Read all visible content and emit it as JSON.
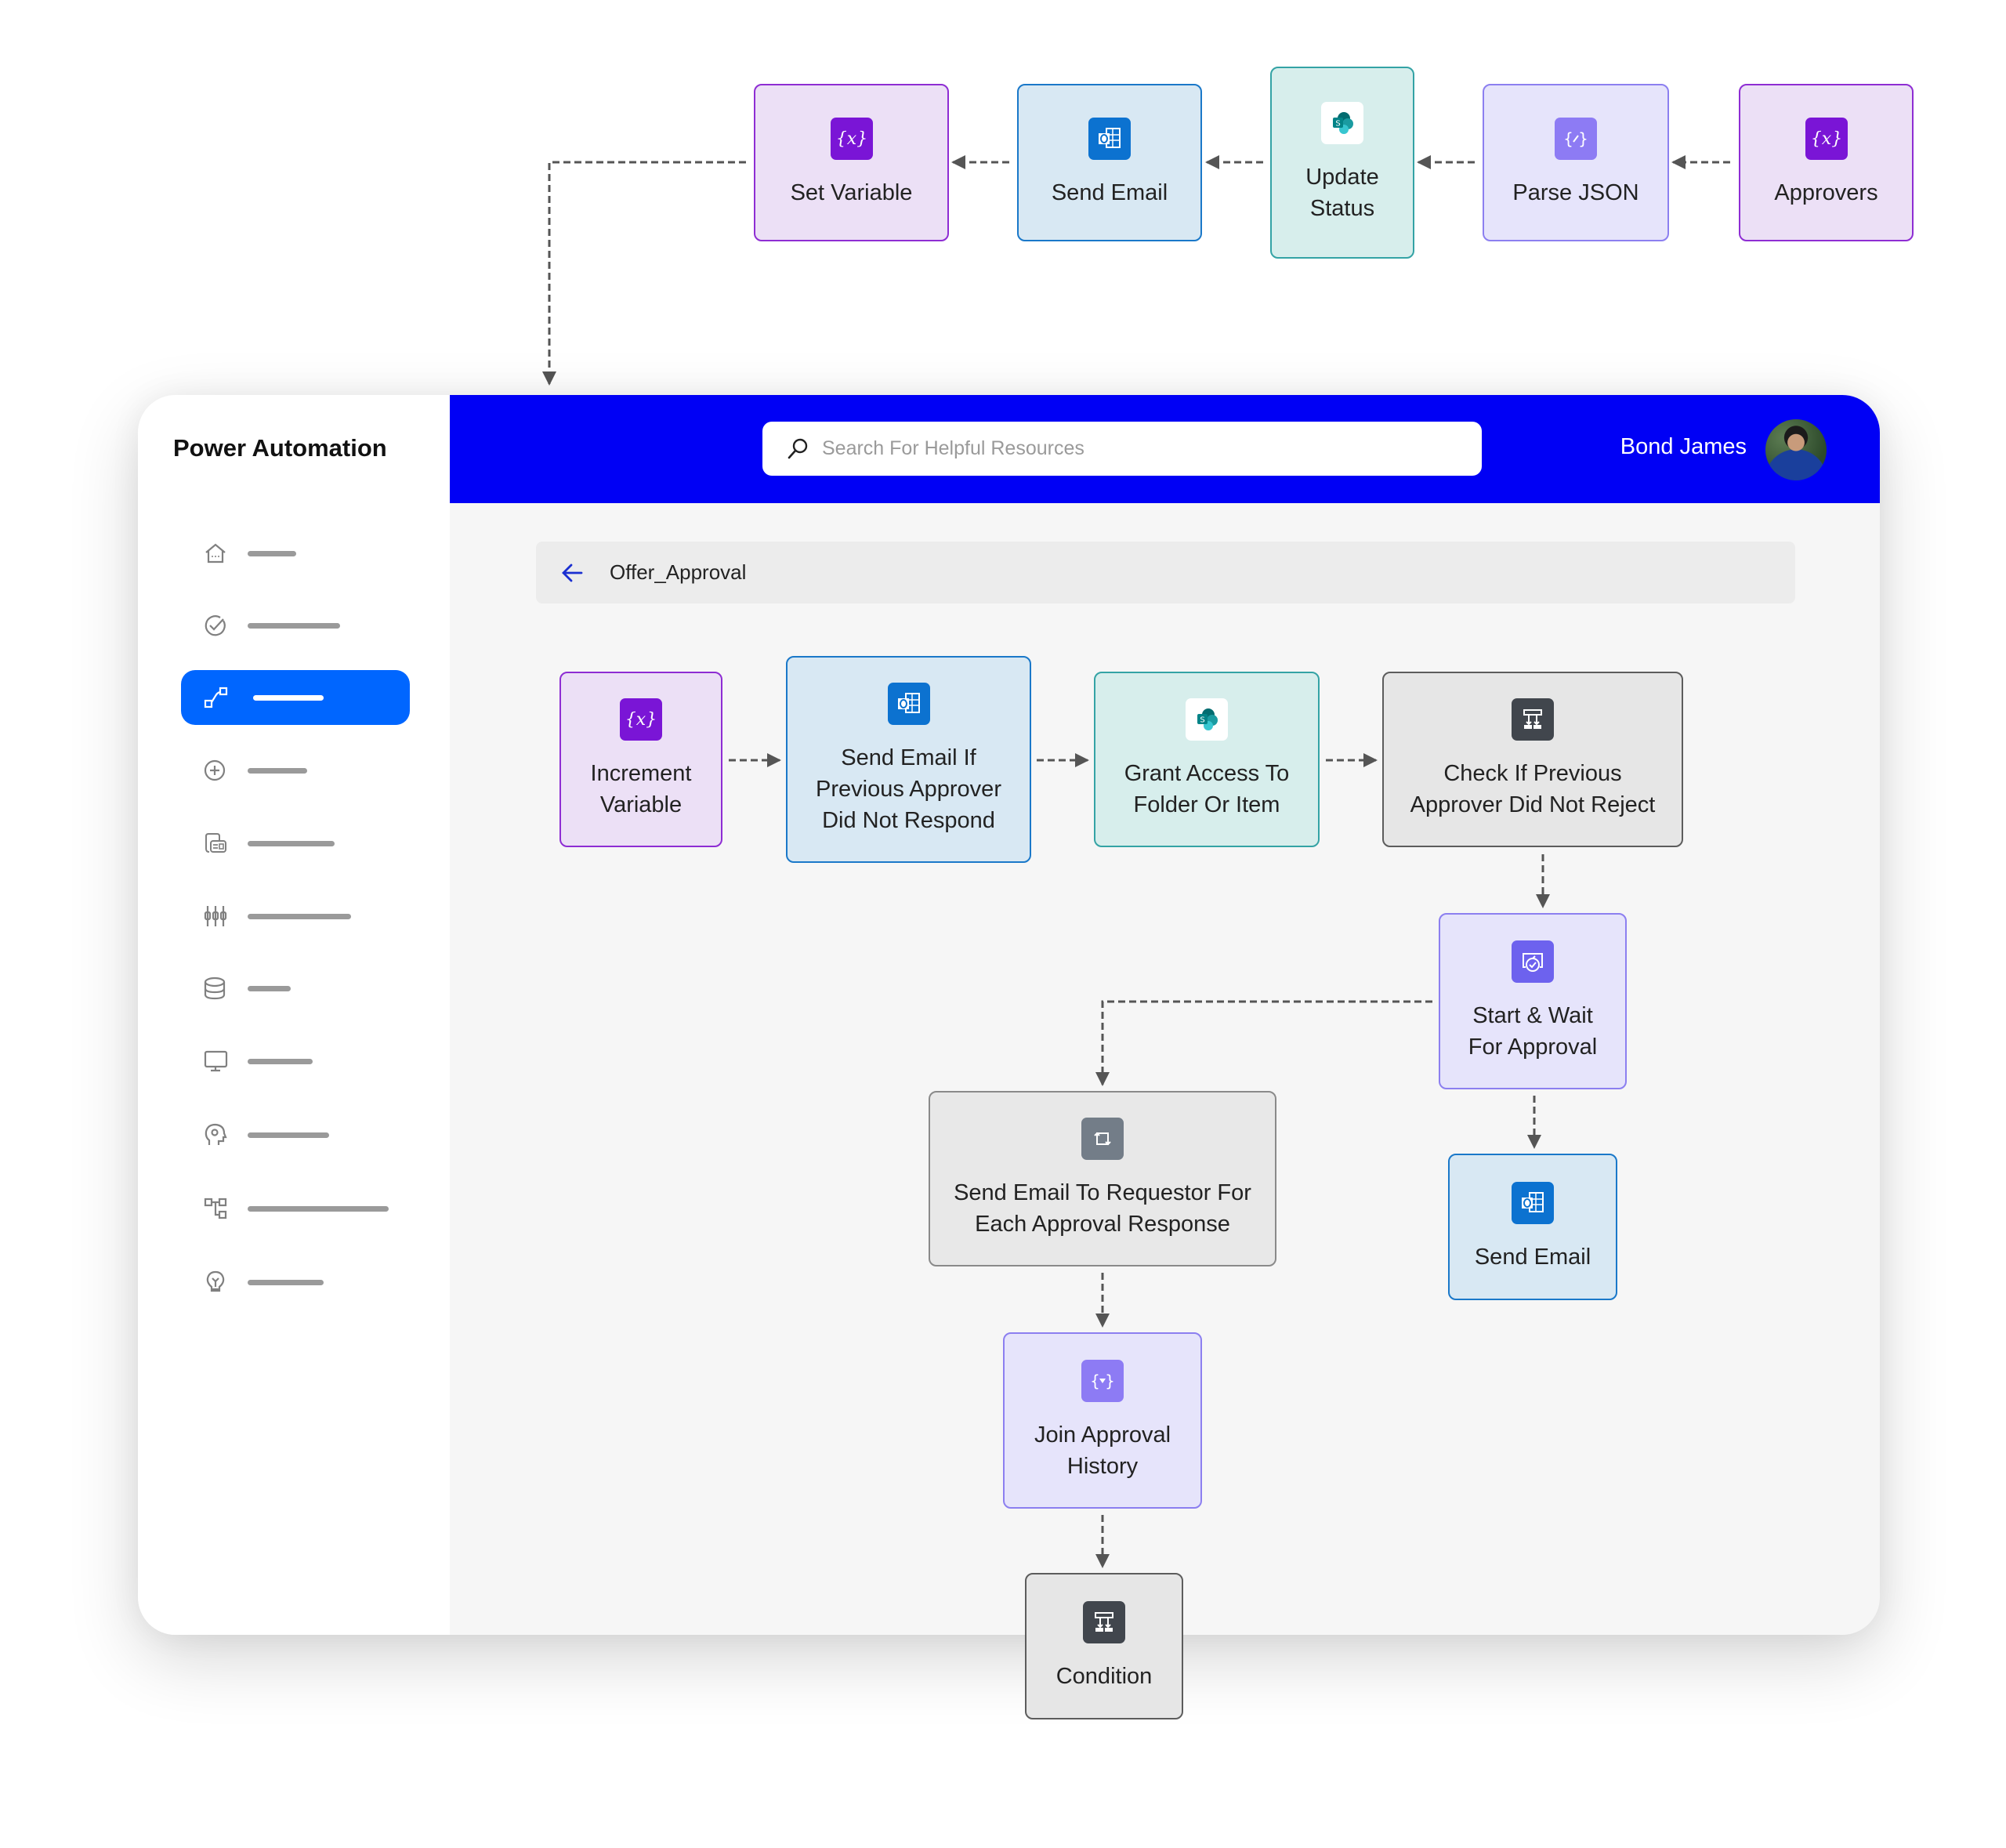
{
  "top_flow": [
    {
      "id": "set-variable",
      "label": "Set Variable",
      "icon": "variable-icon",
      "theme": "purple"
    },
    {
      "id": "send-email-top",
      "label": "Send Email",
      "icon": "outlook-icon",
      "theme": "blue"
    },
    {
      "id": "update-status",
      "label": "Update Status",
      "icon": "sharepoint-icon",
      "theme": "teal"
    },
    {
      "id": "parse-json",
      "label": "Parse JSON",
      "icon": "json-icon",
      "theme": "lavender"
    },
    {
      "id": "approvers",
      "label": "Approvers",
      "icon": "variable-icon",
      "theme": "purple"
    }
  ],
  "app": {
    "brand": "Power Automation",
    "search": {
      "placeholder": "Search For Helpful Resources",
      "value": ""
    },
    "user": {
      "name": "Bond James",
      "avatar": "user-avatar"
    },
    "breadcrumb": {
      "title": "Offer_Approval",
      "back_icon": "arrow-left-icon"
    },
    "accent": "#0000f5",
    "active_nav": "#0066ff",
    "sidebar": {
      "items": [
        {
          "icon": "home-icon",
          "active": false
        },
        {
          "icon": "check-circle-icon",
          "active": false
        },
        {
          "icon": "flow-icon",
          "active": true
        },
        {
          "icon": "plus-circle-icon",
          "active": false
        },
        {
          "icon": "templates-icon",
          "active": false
        },
        {
          "icon": "connectors-icon",
          "active": false
        },
        {
          "icon": "database-icon",
          "active": false
        },
        {
          "icon": "monitor-icon",
          "active": false
        },
        {
          "icon": "ai-head-icon",
          "active": false
        },
        {
          "icon": "process-icon",
          "active": false
        },
        {
          "icon": "lightbulb-icon",
          "active": false
        }
      ]
    }
  },
  "main_flow": [
    {
      "id": "increment-variable",
      "label": "Increment Variable",
      "icon": "variable-icon",
      "theme": "purple"
    },
    {
      "id": "send-email-if",
      "label": "Send Email If Previous Approver Did Not Respond",
      "icon": "outlook-icon",
      "theme": "blue"
    },
    {
      "id": "grant-access",
      "label": "Grant Access To Folder Or Item",
      "icon": "sharepoint-icon",
      "theme": "teal"
    },
    {
      "id": "check-if",
      "label": "Check If Previous Approver Did Not Reject",
      "icon": "condition-icon",
      "theme": "gray"
    },
    {
      "id": "start-wait",
      "label": "Start & Wait For Approval",
      "icon": "approval-icon",
      "theme": "lavender"
    },
    {
      "id": "send-email-requestor",
      "label": "Send Email To Requestor For Each Approval Response",
      "icon": "loop-icon",
      "theme": "gray2"
    },
    {
      "id": "send-email-right",
      "label": "Send Email",
      "icon": "outlook-icon",
      "theme": "blue"
    },
    {
      "id": "join-approval",
      "label": "Join Approval History",
      "icon": "json-icon",
      "theme": "lavender"
    },
    {
      "id": "condition",
      "label": "Condition",
      "icon": "condition-icon",
      "theme": "gray"
    }
  ]
}
